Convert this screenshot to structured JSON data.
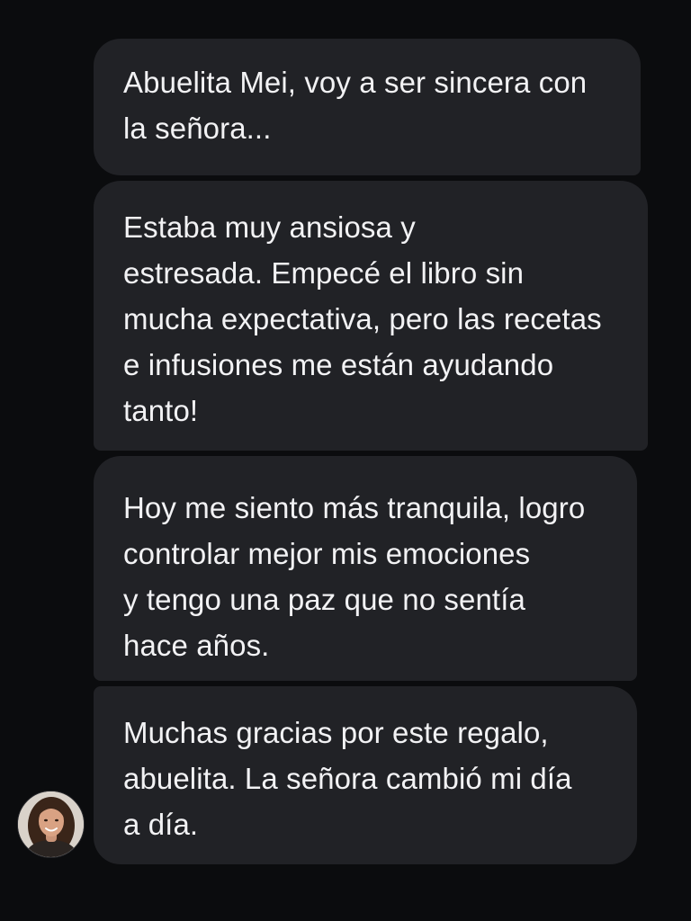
{
  "thread": {
    "messages": [
      {
        "text": "Abuelita Mei, voy a ser sincera con\nla señora..."
      },
      {
        "text": "Estaba muy ansiosa y\nestresada. Empecé el libro sin\nmucha expectativa, pero las recetas\ne infusiones me están ayudando\ntanto!"
      },
      {
        "text": "Hoy me siento más tranquila, logro\ncontrolar mejor mis emociones\ny tengo una paz que no sentía\nhace años."
      },
      {
        "text": "Muchas gracias por este regalo,\nabuelita. La señora cambió mi día\na día."
      }
    ]
  },
  "sender": {
    "avatar_icon": "person-photo-icon"
  },
  "colors": {
    "background": "#0b0c0e",
    "bubble": "#212226",
    "text": "#f2f2f4"
  }
}
